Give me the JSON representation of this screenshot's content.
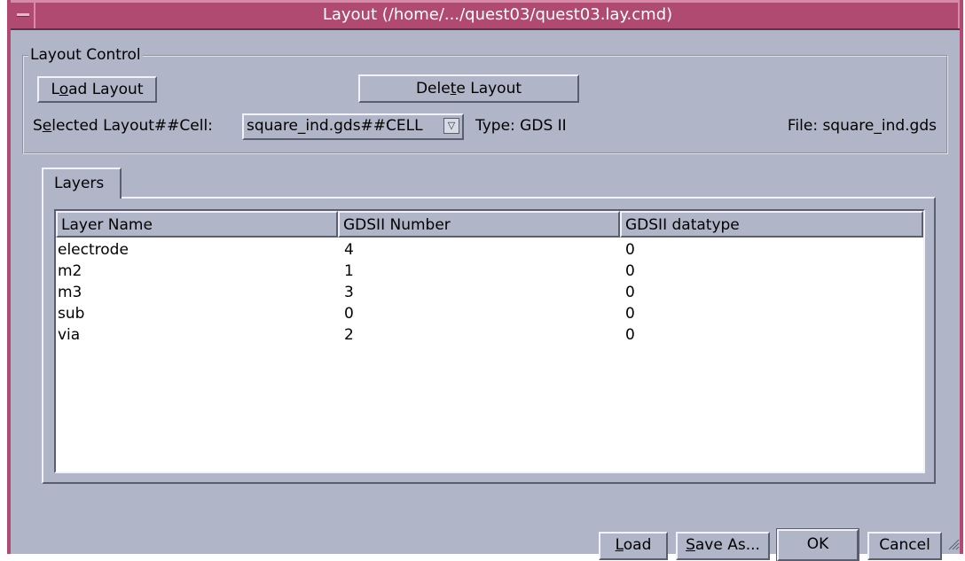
{
  "window": {
    "title": "Layout (/home/.../quest03/quest03.lay.cmd)"
  },
  "layout_control": {
    "legend": "Layout Control",
    "load_layout_pre": "L",
    "load_layout_u": "o",
    "load_layout_post": "ad Layout",
    "delete_layout_pre": "Dele",
    "delete_layout_u": "t",
    "delete_layout_post": "e Layout",
    "selected_label_pre": "S",
    "selected_label_u": "e",
    "selected_label_post": "lected Layout##Cell:",
    "selected_value": "square_ind.gds##CELL",
    "type_label": "Type: GDS II",
    "file_label": "File: square_ind.gds"
  },
  "tabs": [
    {
      "label": "Layers"
    }
  ],
  "layers_table": {
    "columns": [
      "Layer Name",
      "GDSII Number",
      "GDSII datatype"
    ],
    "rows": [
      [
        "electrode",
        "4",
        "0"
      ],
      [
        "m2",
        "1",
        "0"
      ],
      [
        "m3",
        "3",
        "0"
      ],
      [
        "sub",
        "0",
        "0"
      ],
      [
        "via",
        "2",
        "0"
      ]
    ]
  },
  "footer": {
    "load_u": "L",
    "load_post": "oad",
    "save_as_u": "S",
    "save_as_post": "ave As...",
    "ok": "OK",
    "cancel": "Cancel"
  },
  "colors": {
    "titlebar": "#b04a70",
    "background": "#b0b5c8",
    "table_background": "#ffffff"
  }
}
